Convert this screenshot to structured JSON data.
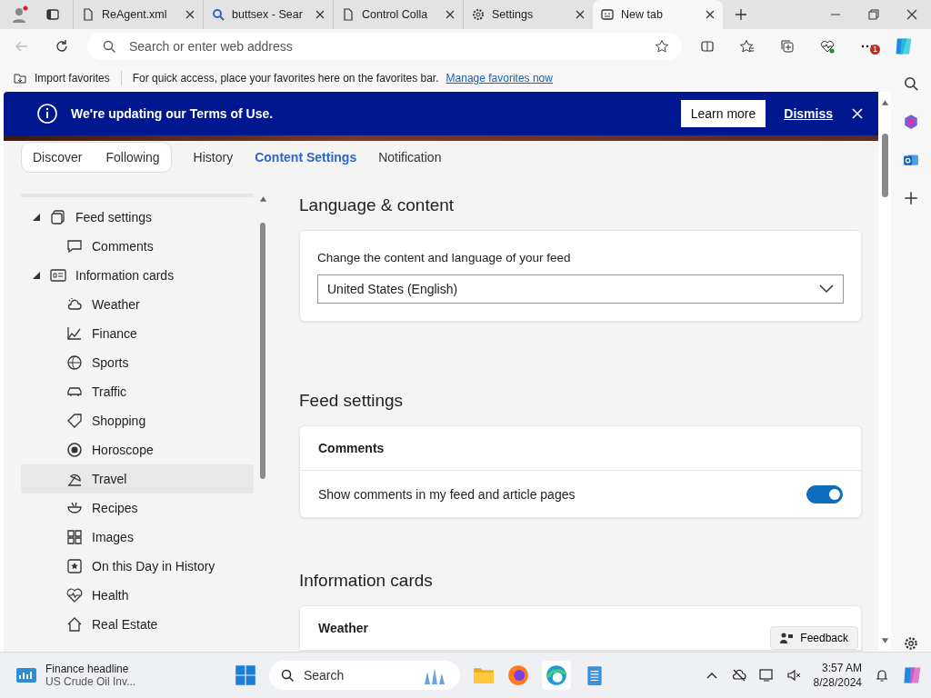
{
  "browser_tabs": [
    {
      "title": "ReAgent.xml",
      "selected": false
    },
    {
      "title": "buttsex - Sear",
      "selected": false
    },
    {
      "title": "Control Colla",
      "selected": false
    },
    {
      "title": "Settings",
      "selected": false
    },
    {
      "title": "New tab",
      "selected": true
    }
  ],
  "address_bar": {
    "placeholder": "Search or enter web address"
  },
  "favorites_bar": {
    "import": "Import favorites",
    "message": "For quick access, place your favorites here on the favorites bar.",
    "link": "Manage favorites now"
  },
  "notifications_badge": "1",
  "banner": {
    "text": "We're updating our Terms of Use.",
    "learn_more": "Learn more",
    "dismiss": "Dismiss"
  },
  "feed_toggle": [
    {
      "label": "Discover",
      "selected": false
    },
    {
      "label": "Following",
      "selected": false
    }
  ],
  "feed_tabs": [
    {
      "label": "History",
      "selected": false
    },
    {
      "label": "Content Settings",
      "selected": true
    },
    {
      "label": "Notification",
      "selected": false
    }
  ],
  "tree": [
    {
      "label": "Feed settings",
      "expanded": true,
      "selected": false,
      "children": [
        {
          "label": "Comments",
          "selected": false
        }
      ]
    },
    {
      "label": "Information cards",
      "expanded": true,
      "selected": false,
      "children": [
        {
          "label": "Weather",
          "selected": false
        },
        {
          "label": "Finance",
          "selected": false
        },
        {
          "label": "Sports",
          "selected": false
        },
        {
          "label": "Traffic",
          "selected": false
        },
        {
          "label": "Shopping",
          "selected": false
        },
        {
          "label": "Horoscope",
          "selected": false
        },
        {
          "label": "Travel",
          "selected": true
        },
        {
          "label": "Recipes",
          "selected": false
        },
        {
          "label": "Images",
          "selected": false
        },
        {
          "label": "On this Day in History",
          "selected": false
        },
        {
          "label": "Health",
          "selected": false
        },
        {
          "label": "Real Estate",
          "selected": false
        }
      ]
    }
  ],
  "language_section": {
    "heading": "Language & content",
    "label": "Change the content and language of your feed",
    "value": "United States (English)"
  },
  "feed_section": {
    "heading": "Feed settings",
    "card_title": "Comments",
    "setting": "Show comments in my feed and article pages",
    "on": true
  },
  "info_section": {
    "heading": "Information cards",
    "card_title": "Weather"
  },
  "feedback": "Feedback",
  "taskbar": {
    "widget_title": "Finance headline",
    "widget_text": "US Crude Oil Inv...",
    "search_placeholder": "Search",
    "time": "3:57 AM",
    "date": "8/28/2024"
  }
}
